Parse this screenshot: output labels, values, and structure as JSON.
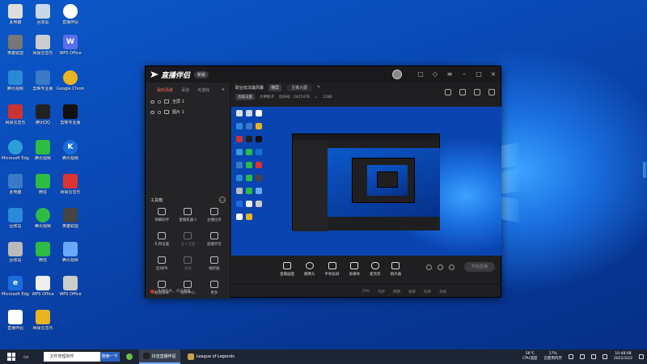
{
  "desktop": {
    "icons": [
      {
        "label": "此电脑",
        "color": "#ddd"
      },
      {
        "label": "回收站",
        "color": "#c8d8e8"
      },
      {
        "label": "Microsoft Edge",
        "color": "#2a9fd8"
      },
      {
        "label": "腾讯QQ",
        "color": "#222"
      },
      {
        "label": "剪映专业版",
        "color": "#111"
      },
      {
        "label": "微信",
        "color": "#2dbb43"
      },
      {
        "label": "英雄联盟",
        "color": "#c8a34a"
      },
      {
        "label": "网易云音乐",
        "color": "#d33"
      },
      {
        "label": "WPS Office",
        "color": "#d8453a"
      },
      {
        "label": "Google Chrome",
        "color": "#e8b422"
      },
      {
        "label": "腾讯视频",
        "color": "#3a8ce0"
      },
      {
        "label": "直播伴侣",
        "color": "#222"
      }
    ]
  },
  "app": {
    "logo_text": "直播伴侣",
    "version_badge": "新版",
    "left_tabs": [
      "我的场景",
      "添加",
      "可游戏"
    ],
    "sources": [
      {
        "name": "全屏 1"
      },
      {
        "name": "图片 1"
      }
    ],
    "toolbox_title": "工具箱",
    "tools": [
      {
        "label": "弹幕助手",
        "dim": false
      },
      {
        "label": "直播机器人",
        "dim": false
      },
      {
        "label": "主播任务",
        "dim": false
      },
      {
        "label": "礼物设置",
        "dim": false
      },
      {
        "label": "多人连麦",
        "dim": true
      },
      {
        "label": "直播带货",
        "dim": false
      },
      {
        "label": "连线PK",
        "dim": false
      },
      {
        "label": "福袋",
        "dim": true
      },
      {
        "label": "抽奖器",
        "dim": false
      },
      {
        "label": "截图录屏",
        "dim": false
      },
      {
        "label": "创作中心",
        "dim": false
      },
      {
        "label": "更多",
        "dim": false
      }
    ],
    "scene_title": "职业玩法最风暴",
    "scene_tag": "横屏",
    "scene_pill": "主推大厦",
    "info_tag": "高级设置",
    "info_user": "大神影子",
    "info_room": "房间号：2425476",
    "info_count": "1280",
    "bottom_tools": [
      "直播画面",
      "摄像头",
      "手机投屏",
      "多媒体",
      "麦克风",
      "扬声器"
    ],
    "start_live": "开始直播",
    "left_status": "礼物任务，点击查看",
    "status_items": [
      "CPU",
      "内存",
      "网络",
      "帧率",
      "码率",
      "丢帧"
    ]
  },
  "taskbar": {
    "search_text": "文件管理软件",
    "search_button": "搜索一下",
    "tasks": [
      {
        "label": "抖音直播伴侣",
        "active": true
      },
      {
        "label": "League of Legends",
        "active": false
      }
    ],
    "weather": {
      "temp": "56°C",
      "desc": "CPU温度"
    },
    "usage": {
      "value": "17%",
      "desc": "已使用内存"
    },
    "time": "10:48:08",
    "date": "2022/3/22"
  }
}
